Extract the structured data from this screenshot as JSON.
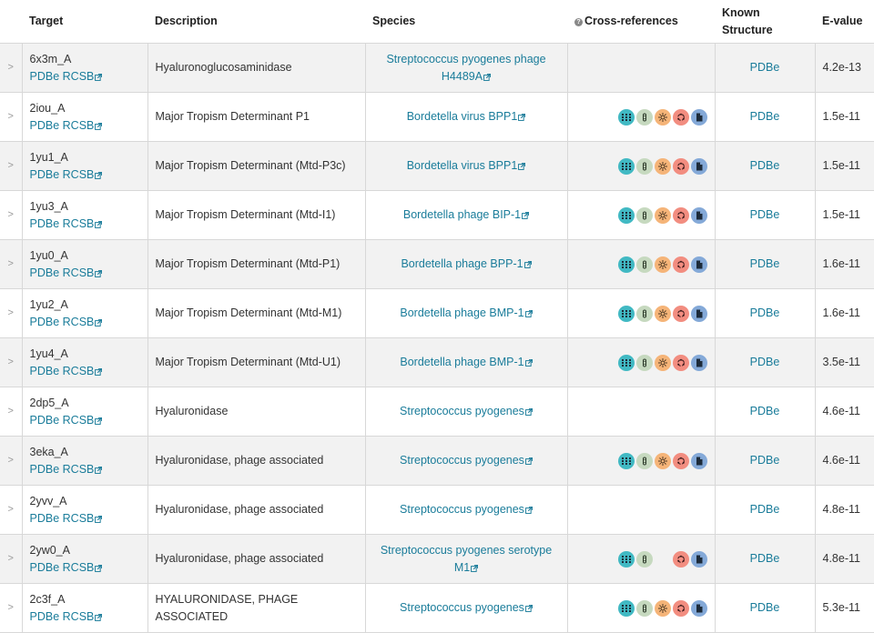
{
  "headers": {
    "target": "Target",
    "description": "Description",
    "species": "Species",
    "crossrefs": "Cross-references",
    "known_structure_line1": "Known",
    "known_structure_line2": "Structure",
    "evalue": "E-value"
  },
  "toggle_glyph": ">",
  "link_labels": {
    "pdbe": "PDBe",
    "rcsb": "RCSB"
  },
  "icon_names": [
    "grid-icon",
    "bacteria-icon",
    "sun-icon",
    "cycle-icon",
    "document-icon"
  ],
  "colors": {
    "link": "#1a7c9a",
    "row_alt": "#f2f2f2",
    "border": "#d8d8d8"
  },
  "rows": [
    {
      "id": "6x3m_A",
      "description": "Hyaluronoglucosaminidase",
      "species": "Streptococcus pyogenes phage H4489A",
      "xrefs": [],
      "known": "PDBe",
      "evalue": "4.2e-13"
    },
    {
      "id": "2iou_A",
      "description": "Major Tropism Determinant P1",
      "species": "Bordetella virus BPP1",
      "xrefs": [
        "grid",
        "bact",
        "sun",
        "cyc",
        "doc"
      ],
      "known": "PDBe",
      "evalue": "1.5e-11"
    },
    {
      "id": "1yu1_A",
      "description": "Major Tropism Determinant (Mtd-P3c)",
      "species": "Bordetella virus BPP1",
      "xrefs": [
        "grid",
        "bact",
        "sun",
        "cyc",
        "doc"
      ],
      "known": "PDBe",
      "evalue": "1.5e-11"
    },
    {
      "id": "1yu3_A",
      "description": "Major Tropism Determinant (Mtd-I1)",
      "species": "Bordetella phage BIP-1",
      "xrefs": [
        "grid",
        "bact",
        "sun",
        "cyc",
        "doc"
      ],
      "known": "PDBe",
      "evalue": "1.5e-11"
    },
    {
      "id": "1yu0_A",
      "description": "Major Tropism Determinant (Mtd-P1)",
      "species": "Bordetella phage BPP-1",
      "xrefs": [
        "grid",
        "bact",
        "sun",
        "cyc",
        "doc"
      ],
      "known": "PDBe",
      "evalue": "1.6e-11"
    },
    {
      "id": "1yu2_A",
      "description": "Major Tropism Determinant (Mtd-M1)",
      "species": "Bordetella phage BMP-1",
      "xrefs": [
        "grid",
        "bact",
        "sun",
        "cyc",
        "doc"
      ],
      "known": "PDBe",
      "evalue": "1.6e-11"
    },
    {
      "id": "1yu4_A",
      "description": "Major Tropism Determinant (Mtd-U1)",
      "species": "Bordetella phage BMP-1",
      "xrefs": [
        "grid",
        "bact",
        "sun",
        "cyc",
        "doc"
      ],
      "known": "PDBe",
      "evalue": "3.5e-11"
    },
    {
      "id": "2dp5_A",
      "description": "Hyaluronidase",
      "species": "Streptococcus pyogenes",
      "xrefs": [],
      "known": "PDBe",
      "evalue": "4.6e-11"
    },
    {
      "id": "3eka_A",
      "description": "Hyaluronidase, phage associated",
      "species": "Streptococcus pyogenes",
      "xrefs": [
        "grid",
        "bact",
        "sun",
        "cyc",
        "doc"
      ],
      "known": "PDBe",
      "evalue": "4.6e-11"
    },
    {
      "id": "2yvv_A",
      "description": "Hyaluronidase, phage associated",
      "species": "Streptococcus pyogenes",
      "xrefs": [],
      "known": "PDBe",
      "evalue": "4.8e-11"
    },
    {
      "id": "2yw0_A",
      "description": "Hyaluronidase, phage associated",
      "species": "Streptococcus pyogenes serotype M1",
      "xrefs": [
        "grid",
        "bact",
        "empty",
        "cyc",
        "doc"
      ],
      "known": "PDBe",
      "evalue": "4.8e-11"
    },
    {
      "id": "2c3f_A",
      "description": "HYALURONIDASE, PHAGE ASSOCIATED",
      "species": "Streptococcus pyogenes",
      "xrefs": [
        "grid",
        "bact",
        "sun",
        "cyc",
        "doc"
      ],
      "known": "PDBe",
      "evalue": "5.3e-11"
    }
  ]
}
